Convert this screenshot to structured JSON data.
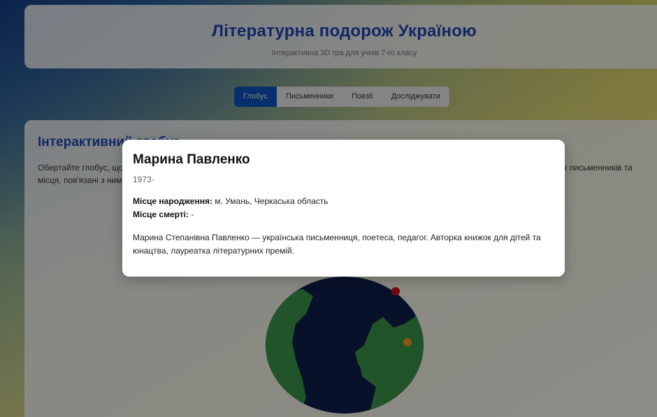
{
  "header": {
    "title": "Літературна подорож Україною",
    "subtitle": "Інтерактивна 3D гра для учнів 7-го класу"
  },
  "tabs": [
    {
      "label": "Глобус",
      "active": true
    },
    {
      "label": "Письменники",
      "active": false
    },
    {
      "label": "Поезії",
      "active": false
    },
    {
      "label": "Досліджувати",
      "active": false
    }
  ],
  "main": {
    "heading": "Інтерактивний глобус",
    "description": "Обертайте глобус, щоб знайти місця, пов'язані з відомими письменниками. Натисніть на маркер, щоб дізнатися більше про українських письменників та місця, пов'язані з ними."
  },
  "modal": {
    "name": "Марина Павленко",
    "years": "1973-",
    "birthplace_label": "Місце народження:",
    "birthplace": "м. Умань, Черкаська область",
    "deathplace_label": "Місце смерті:",
    "deathplace": "-",
    "bio": "Марина Степанівна Павленко — українська письменниця, поетеса, педагог. Авторка книжок для дітей та юнацтва, лауреатка літературних премій."
  },
  "colors": {
    "title": "#1f47b8",
    "tab_active": "#0b57c4",
    "ocean": "#0f1f4d",
    "land": "#3f9a4c",
    "marker_orange": "#f0a020",
    "marker_red": "#d91020"
  }
}
